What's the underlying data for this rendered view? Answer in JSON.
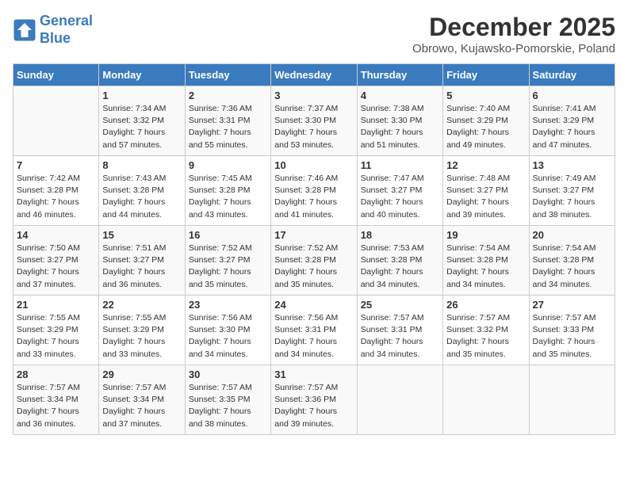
{
  "header": {
    "logo_line1": "General",
    "logo_line2": "Blue",
    "month": "December 2025",
    "location": "Obrowo, Kujawsko-Pomorskie, Poland"
  },
  "days_of_week": [
    "Sunday",
    "Monday",
    "Tuesday",
    "Wednesday",
    "Thursday",
    "Friday",
    "Saturday"
  ],
  "weeks": [
    [
      {
        "day": "",
        "text": ""
      },
      {
        "day": "1",
        "text": "Sunrise: 7:34 AM\nSunset: 3:32 PM\nDaylight: 7 hours\nand 57 minutes."
      },
      {
        "day": "2",
        "text": "Sunrise: 7:36 AM\nSunset: 3:31 PM\nDaylight: 7 hours\nand 55 minutes."
      },
      {
        "day": "3",
        "text": "Sunrise: 7:37 AM\nSunset: 3:30 PM\nDaylight: 7 hours\nand 53 minutes."
      },
      {
        "day": "4",
        "text": "Sunrise: 7:38 AM\nSunset: 3:30 PM\nDaylight: 7 hours\nand 51 minutes."
      },
      {
        "day": "5",
        "text": "Sunrise: 7:40 AM\nSunset: 3:29 PM\nDaylight: 7 hours\nand 49 minutes."
      },
      {
        "day": "6",
        "text": "Sunrise: 7:41 AM\nSunset: 3:29 PM\nDaylight: 7 hours\nand 47 minutes."
      }
    ],
    [
      {
        "day": "7",
        "text": "Sunrise: 7:42 AM\nSunset: 3:28 PM\nDaylight: 7 hours\nand 46 minutes."
      },
      {
        "day": "8",
        "text": "Sunrise: 7:43 AM\nSunset: 3:28 PM\nDaylight: 7 hours\nand 44 minutes."
      },
      {
        "day": "9",
        "text": "Sunrise: 7:45 AM\nSunset: 3:28 PM\nDaylight: 7 hours\nand 43 minutes."
      },
      {
        "day": "10",
        "text": "Sunrise: 7:46 AM\nSunset: 3:28 PM\nDaylight: 7 hours\nand 41 minutes."
      },
      {
        "day": "11",
        "text": "Sunrise: 7:47 AM\nSunset: 3:27 PM\nDaylight: 7 hours\nand 40 minutes."
      },
      {
        "day": "12",
        "text": "Sunrise: 7:48 AM\nSunset: 3:27 PM\nDaylight: 7 hours\nand 39 minutes."
      },
      {
        "day": "13",
        "text": "Sunrise: 7:49 AM\nSunset: 3:27 PM\nDaylight: 7 hours\nand 38 minutes."
      }
    ],
    [
      {
        "day": "14",
        "text": "Sunrise: 7:50 AM\nSunset: 3:27 PM\nDaylight: 7 hours\nand 37 minutes."
      },
      {
        "day": "15",
        "text": "Sunrise: 7:51 AM\nSunset: 3:27 PM\nDaylight: 7 hours\nand 36 minutes."
      },
      {
        "day": "16",
        "text": "Sunrise: 7:52 AM\nSunset: 3:27 PM\nDaylight: 7 hours\nand 35 minutes."
      },
      {
        "day": "17",
        "text": "Sunrise: 7:52 AM\nSunset: 3:28 PM\nDaylight: 7 hours\nand 35 minutes."
      },
      {
        "day": "18",
        "text": "Sunrise: 7:53 AM\nSunset: 3:28 PM\nDaylight: 7 hours\nand 34 minutes."
      },
      {
        "day": "19",
        "text": "Sunrise: 7:54 AM\nSunset: 3:28 PM\nDaylight: 7 hours\nand 34 minutes."
      },
      {
        "day": "20",
        "text": "Sunrise: 7:54 AM\nSunset: 3:28 PM\nDaylight: 7 hours\nand 34 minutes."
      }
    ],
    [
      {
        "day": "21",
        "text": "Sunrise: 7:55 AM\nSunset: 3:29 PM\nDaylight: 7 hours\nand 33 minutes."
      },
      {
        "day": "22",
        "text": "Sunrise: 7:55 AM\nSunset: 3:29 PM\nDaylight: 7 hours\nand 33 minutes."
      },
      {
        "day": "23",
        "text": "Sunrise: 7:56 AM\nSunset: 3:30 PM\nDaylight: 7 hours\nand 34 minutes."
      },
      {
        "day": "24",
        "text": "Sunrise: 7:56 AM\nSunset: 3:31 PM\nDaylight: 7 hours\nand 34 minutes."
      },
      {
        "day": "25",
        "text": "Sunrise: 7:57 AM\nSunset: 3:31 PM\nDaylight: 7 hours\nand 34 minutes."
      },
      {
        "day": "26",
        "text": "Sunrise: 7:57 AM\nSunset: 3:32 PM\nDaylight: 7 hours\nand 35 minutes."
      },
      {
        "day": "27",
        "text": "Sunrise: 7:57 AM\nSunset: 3:33 PM\nDaylight: 7 hours\nand 35 minutes."
      }
    ],
    [
      {
        "day": "28",
        "text": "Sunrise: 7:57 AM\nSunset: 3:34 PM\nDaylight: 7 hours\nand 36 minutes."
      },
      {
        "day": "29",
        "text": "Sunrise: 7:57 AM\nSunset: 3:34 PM\nDaylight: 7 hours\nand 37 minutes."
      },
      {
        "day": "30",
        "text": "Sunrise: 7:57 AM\nSunset: 3:35 PM\nDaylight: 7 hours\nand 38 minutes."
      },
      {
        "day": "31",
        "text": "Sunrise: 7:57 AM\nSunset: 3:36 PM\nDaylight: 7 hours\nand 39 minutes."
      },
      {
        "day": "",
        "text": ""
      },
      {
        "day": "",
        "text": ""
      },
      {
        "day": "",
        "text": ""
      }
    ]
  ]
}
